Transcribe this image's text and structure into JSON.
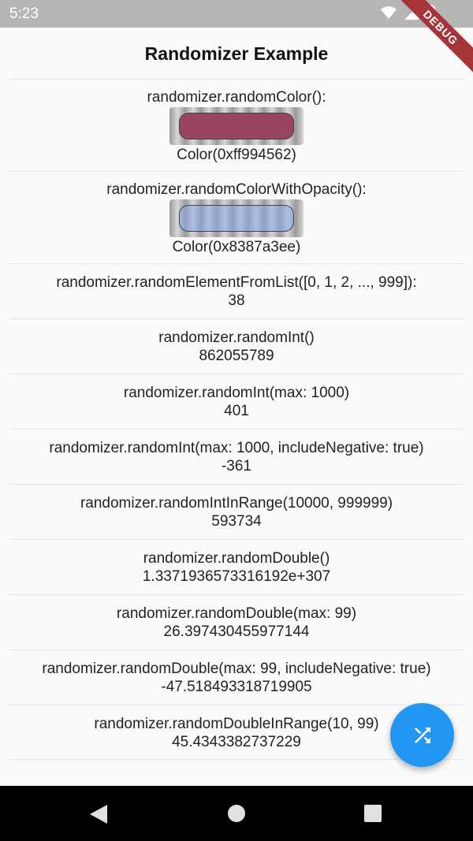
{
  "status_bar": {
    "time": "5:23"
  },
  "debug_banner": "DEBUG",
  "app_bar": {
    "title": "Randomizer Example"
  },
  "colors": {
    "random_color": "#994562",
    "random_color_with_opacity": "rgba(135,167,238,0.51)",
    "fab": "#2196f3"
  },
  "items": [
    {
      "label": "randomizer.randomColor():",
      "value": "Color(0xff994562)"
    },
    {
      "label": "randomizer.randomColorWithOpacity():",
      "value": "Color(0x8387a3ee)"
    },
    {
      "label": "randomizer.randomElementFromList([0, 1, 2, ..., 999]):",
      "value": "38"
    },
    {
      "label": "randomizer.randomInt()",
      "value": "862055789"
    },
    {
      "label": "randomizer.randomInt(max: 1000)",
      "value": "401"
    },
    {
      "label": "randomizer.randomInt(max: 1000, includeNegative: true)",
      "value": "-361"
    },
    {
      "label": "randomizer.randomIntInRange(10000, 999999)",
      "value": "593734"
    },
    {
      "label": "randomizer.randomDouble()",
      "value": "1.3371936573316192e+307"
    },
    {
      "label": "randomizer.randomDouble(max: 99)",
      "value": "26.397430455977144"
    },
    {
      "label": "randomizer.randomDouble(max: 99, includeNegative: true)",
      "value": "-47.518493318719905"
    },
    {
      "label": "randomizer.randomDoubleInRange(10, 99)",
      "value": "45.4343382737229"
    }
  ],
  "icons": {
    "fab": "shuffle-icon",
    "nav_back": "back-triangle-icon",
    "nav_home": "home-circle-icon",
    "nav_recent": "recent-square-icon"
  }
}
